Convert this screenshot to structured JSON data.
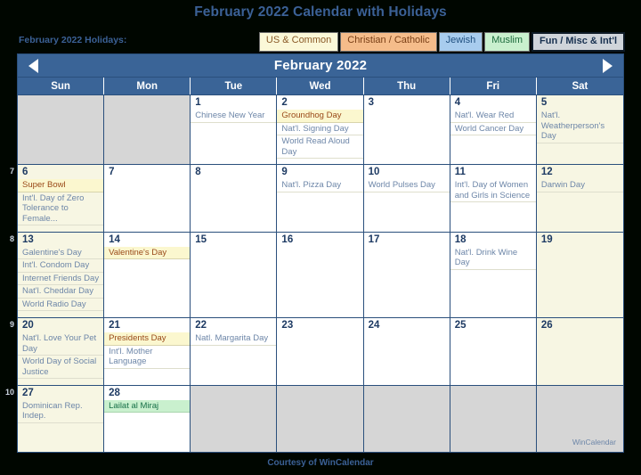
{
  "title": "February 2022 Calendar with Holidays",
  "legend": {
    "label": "February 2022 Holidays:",
    "chips": [
      {
        "name": "US & Common",
        "color": "#fbf8d8"
      },
      {
        "name": "Christian / Catholic",
        "color": "#f5bc8a"
      },
      {
        "name": "Jewish",
        "color": "#a8ccee"
      },
      {
        "name": "Muslim",
        "color": "#c9f0ce"
      },
      {
        "name": "Fun / Misc & Int'l",
        "color": "#cfd4da"
      }
    ]
  },
  "calendar": {
    "month_label": "February 2022",
    "prev_label": "◀",
    "next_label": "▶",
    "weekday_headers": [
      "Sun",
      "Mon",
      "Tue",
      "Wed",
      "Thu",
      "Fri",
      "Sat"
    ],
    "week_numbers": [
      "",
      "7",
      "8",
      "9",
      "10"
    ],
    "watermark": "WinCalendar",
    "weeks": [
      {
        "number": "",
        "days": [
          {
            "num": "",
            "blank": true,
            "weekend": true,
            "events": []
          },
          {
            "num": "",
            "blank": true,
            "weekend": false,
            "events": []
          },
          {
            "num": "1",
            "blank": false,
            "weekend": false,
            "events": [
              {
                "text": "Chinese New Year",
                "type": "plain"
              }
            ]
          },
          {
            "num": "2",
            "blank": false,
            "weekend": false,
            "events": [
              {
                "text": "Groundhog Day",
                "type": "hl-us"
              },
              {
                "text": "Nat'l. Signing Day",
                "type": "plain"
              },
              {
                "text": "World Read Aloud Day",
                "type": "plain"
              }
            ]
          },
          {
            "num": "3",
            "blank": false,
            "weekend": false,
            "events": []
          },
          {
            "num": "4",
            "blank": false,
            "weekend": false,
            "events": [
              {
                "text": "Nat'l. Wear Red",
                "type": "plain"
              },
              {
                "text": "World Cancer Day",
                "type": "plain"
              }
            ]
          },
          {
            "num": "5",
            "blank": false,
            "weekend": true,
            "events": [
              {
                "text": "Nat'l. Weatherperson's Day",
                "type": "plain"
              }
            ]
          }
        ]
      },
      {
        "number": "7",
        "days": [
          {
            "num": "6",
            "blank": false,
            "weekend": true,
            "events": [
              {
                "text": "Super Bowl",
                "type": "hl-us"
              },
              {
                "text": "Int'l. Day of Zero Tolerance to Female...",
                "type": "plain"
              }
            ]
          },
          {
            "num": "7",
            "blank": false,
            "weekend": false,
            "events": []
          },
          {
            "num": "8",
            "blank": false,
            "weekend": false,
            "events": []
          },
          {
            "num": "9",
            "blank": false,
            "weekend": false,
            "events": [
              {
                "text": "Nat'l. Pizza Day",
                "type": "plain"
              }
            ]
          },
          {
            "num": "10",
            "blank": false,
            "weekend": false,
            "events": [
              {
                "text": "World Pulses Day",
                "type": "plain"
              }
            ]
          },
          {
            "num": "11",
            "blank": false,
            "weekend": false,
            "events": [
              {
                "text": "Int'l. Day of Women and Girls in Science",
                "type": "plain"
              }
            ]
          },
          {
            "num": "12",
            "blank": false,
            "weekend": true,
            "events": [
              {
                "text": "Darwin Day",
                "type": "plain"
              }
            ]
          }
        ]
      },
      {
        "number": "8",
        "days": [
          {
            "num": "13",
            "blank": false,
            "weekend": true,
            "events": [
              {
                "text": "Galentine's Day",
                "type": "plain"
              },
              {
                "text": "Int'l. Condom Day",
                "type": "plain"
              },
              {
                "text": "Internet Friends Day",
                "type": "plain"
              },
              {
                "text": "Nat'l. Cheddar Day",
                "type": "plain"
              },
              {
                "text": "World Radio Day",
                "type": "plain"
              }
            ]
          },
          {
            "num": "14",
            "blank": false,
            "weekend": false,
            "events": [
              {
                "text": "Valentine's Day",
                "type": "hl-us"
              }
            ]
          },
          {
            "num": "15",
            "blank": false,
            "weekend": false,
            "events": []
          },
          {
            "num": "16",
            "blank": false,
            "weekend": false,
            "events": []
          },
          {
            "num": "17",
            "blank": false,
            "weekend": false,
            "events": []
          },
          {
            "num": "18",
            "blank": false,
            "weekend": false,
            "events": [
              {
                "text": "Nat'l. Drink Wine Day",
                "type": "plain"
              }
            ]
          },
          {
            "num": "19",
            "blank": false,
            "weekend": true,
            "events": []
          }
        ]
      },
      {
        "number": "9",
        "days": [
          {
            "num": "20",
            "blank": false,
            "weekend": true,
            "events": [
              {
                "text": "Nat'l. Love Your Pet Day",
                "type": "plain"
              },
              {
                "text": "World Day of Social Justice",
                "type": "plain"
              }
            ]
          },
          {
            "num": "21",
            "blank": false,
            "weekend": false,
            "events": [
              {
                "text": "Presidents Day",
                "type": "hl-us"
              },
              {
                "text": "Int'l. Mother Language",
                "type": "plain"
              }
            ]
          },
          {
            "num": "22",
            "blank": false,
            "weekend": false,
            "events": [
              {
                "text": "Natl. Margarita Day",
                "type": "plain"
              }
            ]
          },
          {
            "num": "23",
            "blank": false,
            "weekend": false,
            "events": []
          },
          {
            "num": "24",
            "blank": false,
            "weekend": false,
            "events": []
          },
          {
            "num": "25",
            "blank": false,
            "weekend": false,
            "events": []
          },
          {
            "num": "26",
            "blank": false,
            "weekend": true,
            "events": []
          }
        ]
      },
      {
        "number": "10",
        "days": [
          {
            "num": "27",
            "blank": false,
            "weekend": true,
            "events": [
              {
                "text": "Dominican Rep. Indep.",
                "type": "plain"
              }
            ]
          },
          {
            "num": "28",
            "blank": false,
            "weekend": false,
            "events": [
              {
                "text": "Lailat al Miraj",
                "type": "hl-muslim"
              }
            ]
          },
          {
            "num": "",
            "blank": true,
            "weekend": false,
            "events": []
          },
          {
            "num": "",
            "blank": true,
            "weekend": false,
            "events": []
          },
          {
            "num": "",
            "blank": true,
            "weekend": false,
            "events": []
          },
          {
            "num": "",
            "blank": true,
            "weekend": false,
            "events": []
          },
          {
            "num": "",
            "blank": true,
            "weekend": true,
            "events": []
          }
        ]
      }
    ]
  },
  "footer": "Courtesy of WinCalendar"
}
